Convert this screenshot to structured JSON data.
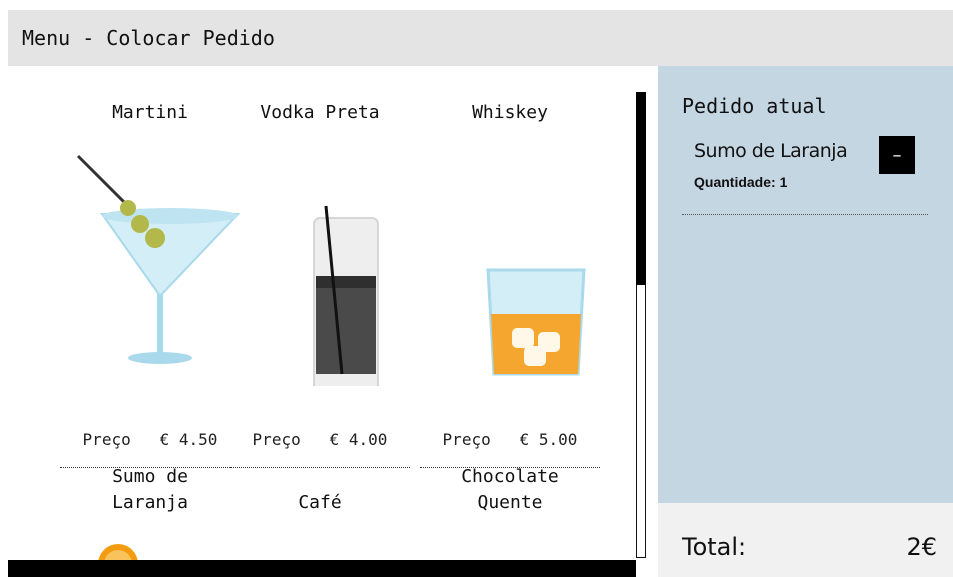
{
  "header": {
    "title": "Menu - Colocar Pedido"
  },
  "menu": {
    "price_label": "Preço",
    "currency": "€",
    "items": [
      {
        "name": "Martini",
        "price": "4.50",
        "icon": "martini-icon"
      },
      {
        "name": "Vodka Preta",
        "price": "4.00",
        "icon": "vodka-glass-icon"
      },
      {
        "name": "Whiskey",
        "price": "5.00",
        "icon": "whiskey-glass-icon"
      },
      {
        "name_line1": "Sumo de",
        "name_line2": "Laranja",
        "icon": "orange-juice-icon"
      },
      {
        "name": "Café"
      },
      {
        "name_line1": "Chocolate",
        "name_line2": "Quente"
      }
    ]
  },
  "order": {
    "title": "Pedido atual",
    "items": [
      {
        "name": "Sumo de Laranja",
        "quantity_label": "Quantidade:",
        "quantity": "1",
        "remove_label": "–"
      }
    ],
    "total_label": "Total:",
    "total_value": "2€"
  },
  "colors": {
    "header_bg": "#e4e4e4",
    "order_panel_bg": "#c5d6e3",
    "total_bg": "#f1f1f1",
    "button_bg": "#000000"
  }
}
